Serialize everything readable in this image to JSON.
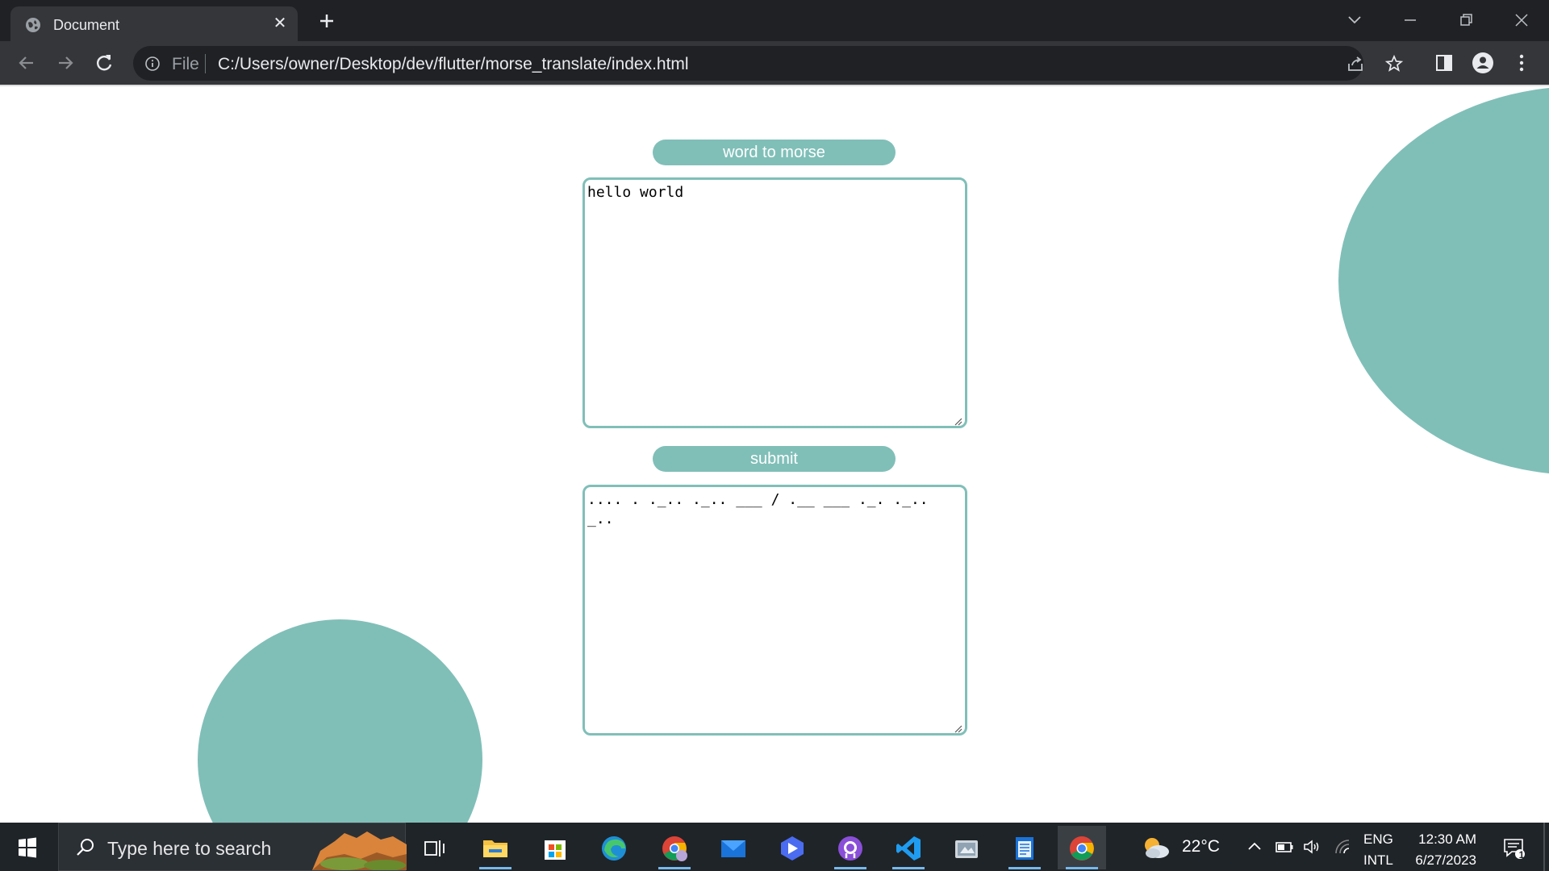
{
  "browser": {
    "tab": {
      "title": "Document",
      "close": "✕"
    },
    "new_tab": "+",
    "omnibox": {
      "scheme": "File",
      "url": "C:/Users/owner/Desktop/dev/flutter/morse_translate/index.html"
    }
  },
  "page": {
    "heading": "word to morse",
    "input_value": "hello world",
    "submit_label": "submit",
    "output_value": ".... . ._.. ._.. ___ / .__ ___ ._. ._.. _..",
    "accent_color": "#80bfb8"
  },
  "taskbar": {
    "search_placeholder": "Type here to search",
    "apps": [
      "task-view",
      "file-explorer",
      "microsoft-store",
      "edge",
      "chrome-profile",
      "mail",
      "power-automate",
      "github-desktop",
      "vscode",
      "snipping-tool",
      "notepad",
      "chrome"
    ],
    "weather": {
      "temp": "22°C"
    },
    "language": {
      "line1": "ENG",
      "line2": "INTL"
    },
    "clock": {
      "time": "12:30 AM",
      "date": "6/27/2023"
    },
    "notifications": "1"
  }
}
